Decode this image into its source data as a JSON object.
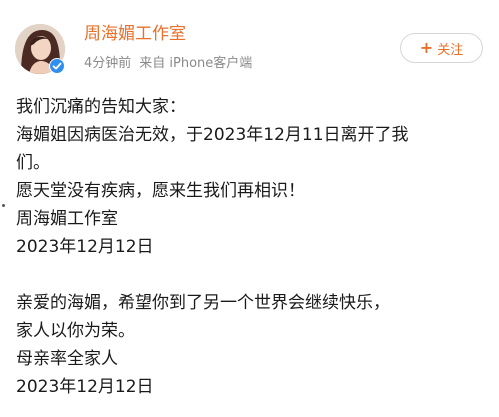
{
  "post": {
    "author": {
      "name": "周海媚工作室",
      "verified": true,
      "avatar_icon": "avatar-portrait-icon"
    },
    "meta": {
      "time": "4分钟前",
      "source": "来自 iPhone客户端"
    },
    "follow_button": {
      "icon": "+",
      "label": "关注"
    },
    "body_lines": [
      "我们沉痛的告知大家：",
      "海媚姐因病医治无效，于2023年12月11日离开了我",
      "们。",
      "愿天堂没有疾病，愿来生我们再相识！",
      "周海媚工作室",
      "2023年12月12日",
      "",
      "亲爱的海媚，希望你到了另一个世界会继续快乐，",
      "家人以你为荣。",
      "母亲率全家人",
      "2023年12月12日"
    ]
  },
  "colors": {
    "accent": "#e8702a",
    "meta_text": "#8a8a8a",
    "body_text": "#1a1a1a",
    "verified": "#2f8ff0"
  }
}
